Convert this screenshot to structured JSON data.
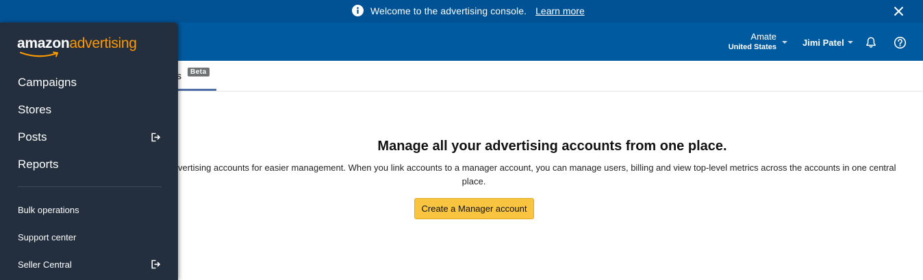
{
  "banner": {
    "message": "Welcome to the advertising console.",
    "link": "Learn more",
    "icons": {
      "info": "info-circle-icon",
      "close": "close-icon"
    }
  },
  "header": {
    "account_name": "Amate",
    "account_country": "United States",
    "user_name": "Jimi Patel",
    "icons": {
      "notifications": "bell-icon",
      "help": "help-circle-icon"
    }
  },
  "tabs": {
    "partial_label": "s",
    "badge": "Beta"
  },
  "main": {
    "headline": "Manage all your advertising accounts from one place.",
    "description_line1": "vertising accounts for easier management. When you link accounts to a manager account, you can manage users, billing and view top-level metrics across the accounts in one central",
    "description_line2": "place.",
    "cta_label": "Create a Manager account"
  },
  "sidebar": {
    "logo_primary": "amazon",
    "logo_secondary": "advertising",
    "primary_items": [
      {
        "label": "Campaigns",
        "external": false
      },
      {
        "label": "Stores",
        "external": false
      },
      {
        "label": "Posts",
        "external": true
      },
      {
        "label": "Reports",
        "external": false
      }
    ],
    "secondary_items": [
      {
        "label": "Bulk operations",
        "external": false
      },
      {
        "label": "Support center",
        "external": false
      },
      {
        "label": "Seller Central",
        "external": true
      }
    ]
  },
  "colors": {
    "banner_bg": "#005295",
    "header_bg": "#005aa0",
    "sidebar_bg": "#232f3e",
    "logo_accent": "#ff9900",
    "cta_bg": "#f9c440",
    "tab_active": "#4f6da6",
    "beta_badge": "#6f7373"
  }
}
